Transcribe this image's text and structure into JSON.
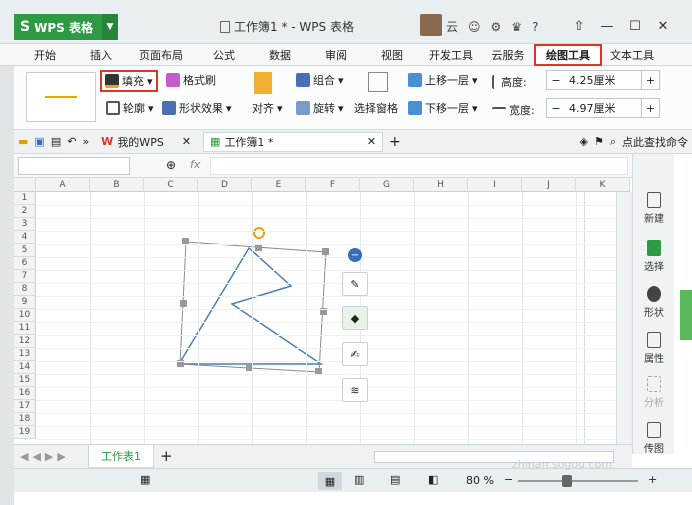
{
  "app": {
    "name": "WPS 表格",
    "logo": "S",
    "document_title": "工作簿1 * - WPS 表格",
    "user": "云"
  },
  "tabs": [
    "开始",
    "插入",
    "页面布局",
    "公式",
    "数据",
    "审阅",
    "视图",
    "开发工具",
    "云服务",
    "绘图工具",
    "文本工具"
  ],
  "ribbon": {
    "fill_label": "填充",
    "format_brush_label": "格式刷",
    "outline_label": "轮廓",
    "shape_effect_label": "形状效果",
    "align_label": "对齐",
    "group_label": "组合",
    "rotate_label": "旋转",
    "selection_pane_label": "选择窗格",
    "bring_forward_label": "上移一层",
    "send_backward_label": "下移一层",
    "height_label": "高度:",
    "height_value": "4.25厘米",
    "width_label": "宽度:",
    "width_value": "4.97厘米"
  },
  "quickbar": {
    "my_wps_label": "我的WPS",
    "doc_tab_label": "工作簿1 *",
    "find_command_label": "点此查找命令"
  },
  "formula": {
    "fx_label": "fx"
  },
  "columns": [
    "A",
    "B",
    "C",
    "D",
    "E",
    "F",
    "G",
    "H",
    "I",
    "J",
    "K"
  ],
  "rows": [
    "1",
    "2",
    "3",
    "4",
    "5",
    "6",
    "7",
    "8",
    "9",
    "10",
    "11",
    "12",
    "13",
    "14",
    "15",
    "16",
    "17",
    "18",
    "19"
  ],
  "side_panel": {
    "new_label": "新建",
    "select_label": "选择",
    "shape_label": "形状",
    "property_label": "属性",
    "analyze_label": "分析",
    "backup_label": "传图"
  },
  "sheet": {
    "tab_label": "工作表1",
    "add_label": "+"
  },
  "status": {
    "zoom_value": "80 %"
  },
  "watermark": "zhinan.sogou.com",
  "colors": {
    "accent_green": "#2e9a43",
    "highlight_red": "#e0332a",
    "shape_stroke": "#4a7fb5"
  }
}
